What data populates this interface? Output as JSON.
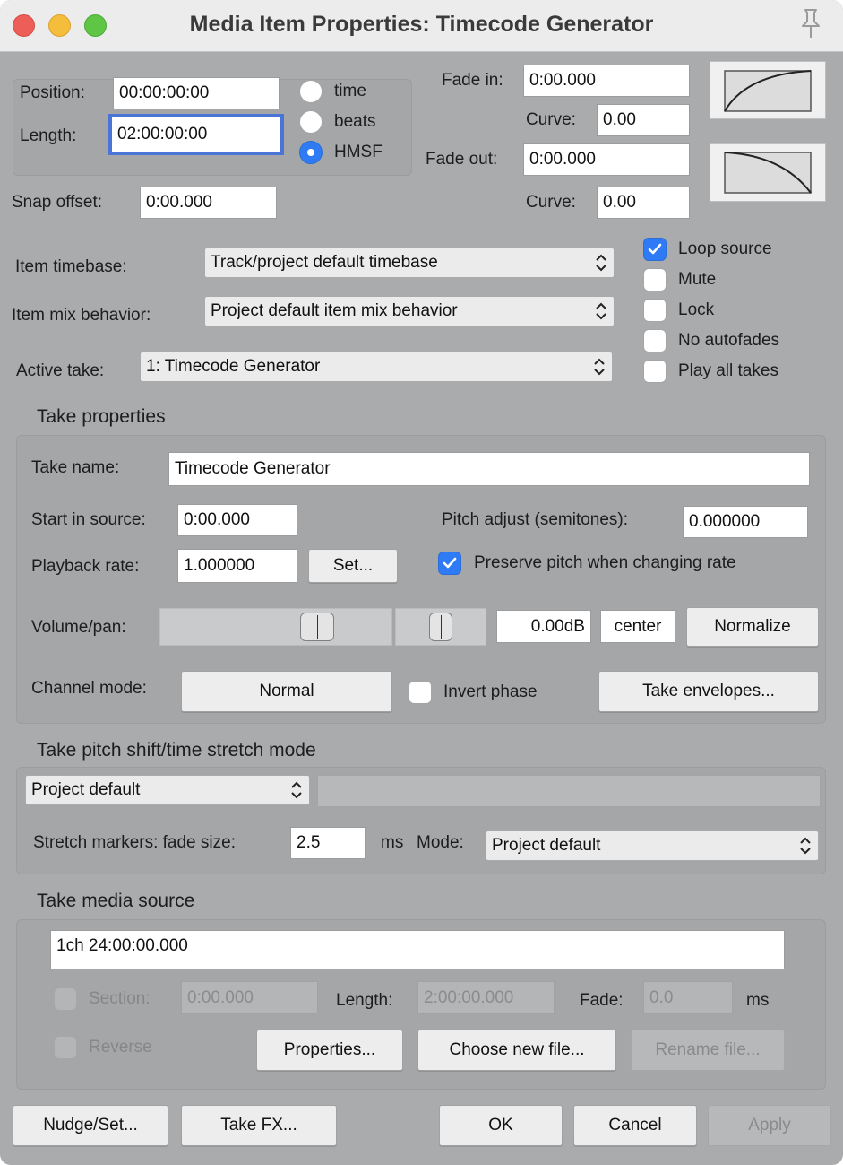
{
  "window": {
    "title": "Media Item Properties:  Timecode Generator"
  },
  "item": {
    "position_label": "Position:",
    "position_value": "00:00:00:00",
    "length_label": "Length:",
    "length_value": "02:00:00:00",
    "timebase_options": [
      "time",
      "beats",
      "HMSF"
    ],
    "timebase_selected": "HMSF",
    "snap_offset_label": "Snap offset:",
    "snap_offset_value": "0:00.000",
    "fade_in_label": "Fade in:",
    "fade_in_value": "0:00.000",
    "fade_in_curve_label": "Curve:",
    "fade_in_curve_value": "0.00",
    "fade_out_label": "Fade out:",
    "fade_out_value": "0:00.000",
    "fade_out_curve_label": "Curve:",
    "fade_out_curve_value": "0.00",
    "item_timebase_label": "Item timebase:",
    "item_timebase_value": "Track/project default timebase",
    "mix_behavior_label": "Item mix behavior:",
    "mix_behavior_value": "Project default item mix behavior",
    "active_take_label": "Active take:",
    "active_take_value": "1: Timecode Generator",
    "checkboxes": [
      {
        "label": "Loop source",
        "checked": true
      },
      {
        "label": "Mute",
        "checked": false
      },
      {
        "label": "Lock",
        "checked": false
      },
      {
        "label": "No autofades",
        "checked": false
      },
      {
        "label": "Play all takes",
        "checked": false
      }
    ]
  },
  "take": {
    "section_title": "Take properties",
    "name_label": "Take name:",
    "name_value": "Timecode Generator",
    "start_label": "Start in source:",
    "start_value": "0:00.000",
    "pitch_label": "Pitch adjust (semitones):",
    "pitch_value": "0.000000",
    "rate_label": "Playback rate:",
    "rate_value": "1.000000",
    "set_button": "Set...",
    "preserve_pitch_label": "Preserve pitch when changing rate",
    "preserve_pitch_checked": true,
    "volpan_label": "Volume/pan:",
    "volume_value": "0.00dB",
    "pan_value": "center",
    "normalize_button": "Normalize",
    "channel_mode_label": "Channel mode:",
    "channel_mode_value": "Normal",
    "invert_phase_label": "Invert phase",
    "invert_phase_checked": false,
    "envelopes_button": "Take envelopes..."
  },
  "stretch": {
    "section_title": "Take pitch shift/time stretch mode",
    "mode_value": "Project default",
    "fade_size_label": "Stretch markers: fade size:",
    "fade_size_value": "2.5",
    "fade_size_unit": "ms",
    "mode_label": "Mode:",
    "marker_mode_value": "Project default"
  },
  "source": {
    "section_title": "Take media source",
    "source_value": "1ch 24:00:00.000",
    "section_label": "Section:",
    "section_value": "0:00.000",
    "length_label": "Length:",
    "length_value": "2:00:00.000",
    "fade_label": "Fade:",
    "fade_value": "0.0",
    "fade_unit": "ms",
    "reverse_label": "Reverse",
    "properties_button": "Properties...",
    "choose_button": "Choose new file...",
    "rename_button": "Rename file..."
  },
  "footer": {
    "nudge_button": "Nudge/Set...",
    "fx_button": "Take FX...",
    "ok_button": "OK",
    "cancel_button": "Cancel",
    "apply_button": "Apply"
  },
  "colors": {
    "accent": "#2f7bf6",
    "panel": "#a9abad",
    "focus": "#4a74d6"
  }
}
